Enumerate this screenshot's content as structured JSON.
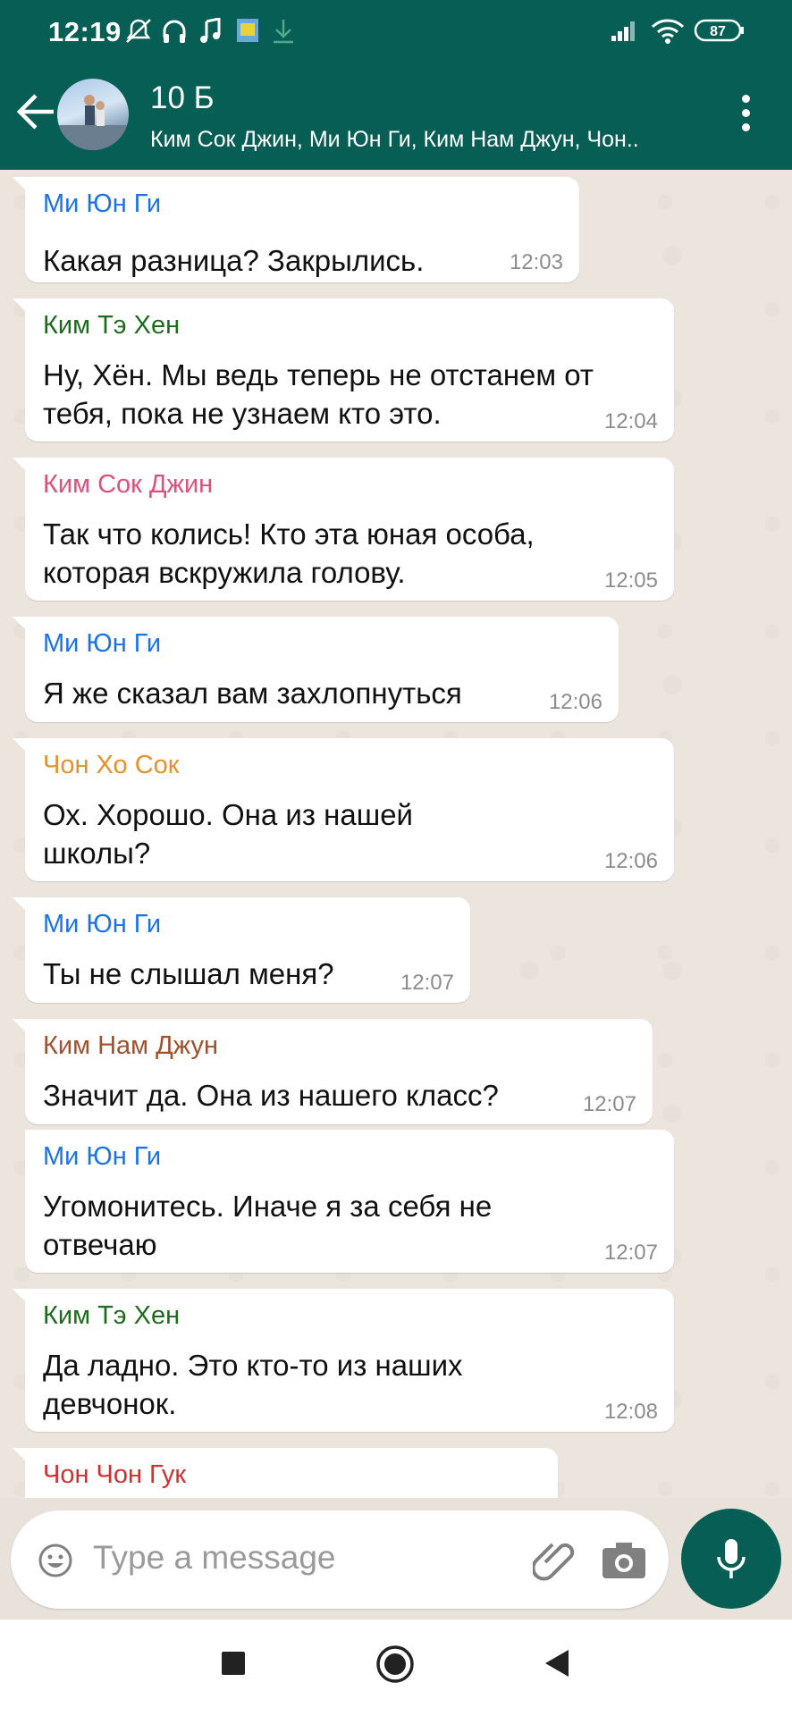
{
  "status_bar": {
    "time": "12:19",
    "battery": "87",
    "icons": [
      "mute-icon",
      "headphones-icon",
      "music-note-icon",
      "app-icon",
      "download-icon",
      "signal-icon",
      "wifi-icon",
      "battery-icon"
    ]
  },
  "header": {
    "title": "10 Б",
    "subtitle": "Ким Сок Джин, Ми Юн Ги, Ким Нам Джун, Чон..",
    "back_icon": "back-arrow-icon",
    "menu_icon": "more-vert-icon"
  },
  "messages": [
    {
      "sender": "Ми Юн Ги",
      "sender_color": "#1a73e8",
      "lines": [
        "Какая разница? Закрылись."
      ],
      "time": "12:03"
    },
    {
      "sender": "Ким Тэ Хен",
      "sender_color": "#1e6b1e",
      "lines": [
        "Ну, Хён. Мы ведь теперь не отстанем от",
        "тебя, пока не узнаем кто это."
      ],
      "time": "12:04"
    },
    {
      "sender": "Ким Сок Джин",
      "sender_color": "#e0507a",
      "lines": [
        "Так что колись! Кто эта юная особа,",
        "которая вскружила голову."
      ],
      "time": "12:05"
    },
    {
      "sender": "Ми Юн Ги",
      "sender_color": "#1a73e8",
      "lines": [
        "Я же сказал вам захлопнуться"
      ],
      "time": "12:06"
    },
    {
      "sender": "Чон Хо Сок",
      "sender_color": "#e8902a",
      "lines": [
        "Ох. Хорошо. Она из нашей",
        "школы?"
      ],
      "time": "12:06"
    },
    {
      "sender": "Ми Юн Ги",
      "sender_color": "#1a73e8",
      "lines": [
        "Ты не слышал меня?"
      ],
      "time": "12:07"
    },
    {
      "sender": "Ким Нам Джун",
      "sender_color": "#a0522d",
      "lines": [
        "Значит да. Она из нашего класс?"
      ],
      "time": "12:07"
    },
    {
      "sender": "Ми Юн Ги",
      "sender_color": "#1a73e8",
      "lines": [
        "Угомонитесь. Иначе я за себя не",
        "отвечаю"
      ],
      "time": "12:07"
    },
    {
      "sender": "Ким Тэ Хен",
      "sender_color": "#1e6b1e",
      "lines": [
        "Да ладно. Это кто-то из наших",
        "девчонок."
      ],
      "time": "12:08"
    },
    {
      "sender": "Чон Чон Гук",
      "sender_color": "#d32f2f",
      "lines": [],
      "time": ""
    }
  ],
  "composer": {
    "placeholder": "Type a message",
    "emoji_icon": "emoji-icon",
    "attach_icon": "paperclip-icon",
    "camera_icon": "camera-icon",
    "mic_icon": "microphone-icon"
  },
  "colors": {
    "primary": "#075e54",
    "chat_background": "#ece5dd",
    "bubble": "#ffffff"
  },
  "nav": [
    "recents-square-icon",
    "home-circle-icon",
    "back-triangle-icon"
  ]
}
